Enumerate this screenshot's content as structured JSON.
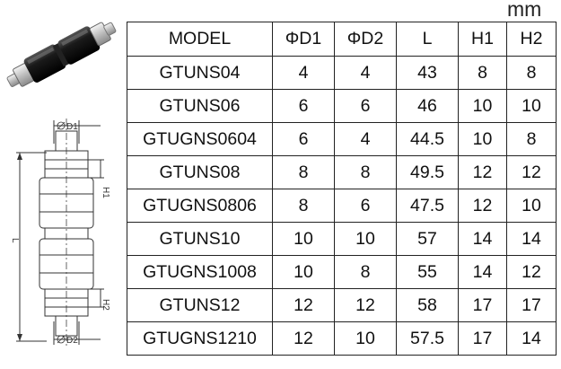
{
  "unit_label": "mm",
  "drawing": {
    "d1_label": "D1",
    "d2_label": "D2",
    "h1_label": "H1",
    "h2_label": "H2",
    "l_label": "L"
  },
  "table": {
    "headers": [
      "MODEL",
      "ΦD1",
      "ΦD2",
      "L",
      "H1",
      "H2"
    ],
    "rows": [
      [
        "GTUNS04",
        "4",
        "4",
        "43",
        "8",
        "8"
      ],
      [
        "GTUNS06",
        "6",
        "6",
        "46",
        "10",
        "10"
      ],
      [
        "GTUGNS0604",
        "6",
        "4",
        "44.5",
        "10",
        "8"
      ],
      [
        "GTUNS08",
        "8",
        "8",
        "49.5",
        "12",
        "12"
      ],
      [
        "GTUGNS0806",
        "8",
        "6",
        "47.5",
        "12",
        "10"
      ],
      [
        "GTUNS10",
        "10",
        "10",
        "57",
        "14",
        "14"
      ],
      [
        "GTUGNS1008",
        "10",
        "8",
        "55",
        "14",
        "12"
      ],
      [
        "GTUNS12",
        "12",
        "12",
        "58",
        "17",
        "17"
      ],
      [
        "GTUGNS1210",
        "12",
        "10",
        "57.5",
        "17",
        "14"
      ]
    ]
  }
}
